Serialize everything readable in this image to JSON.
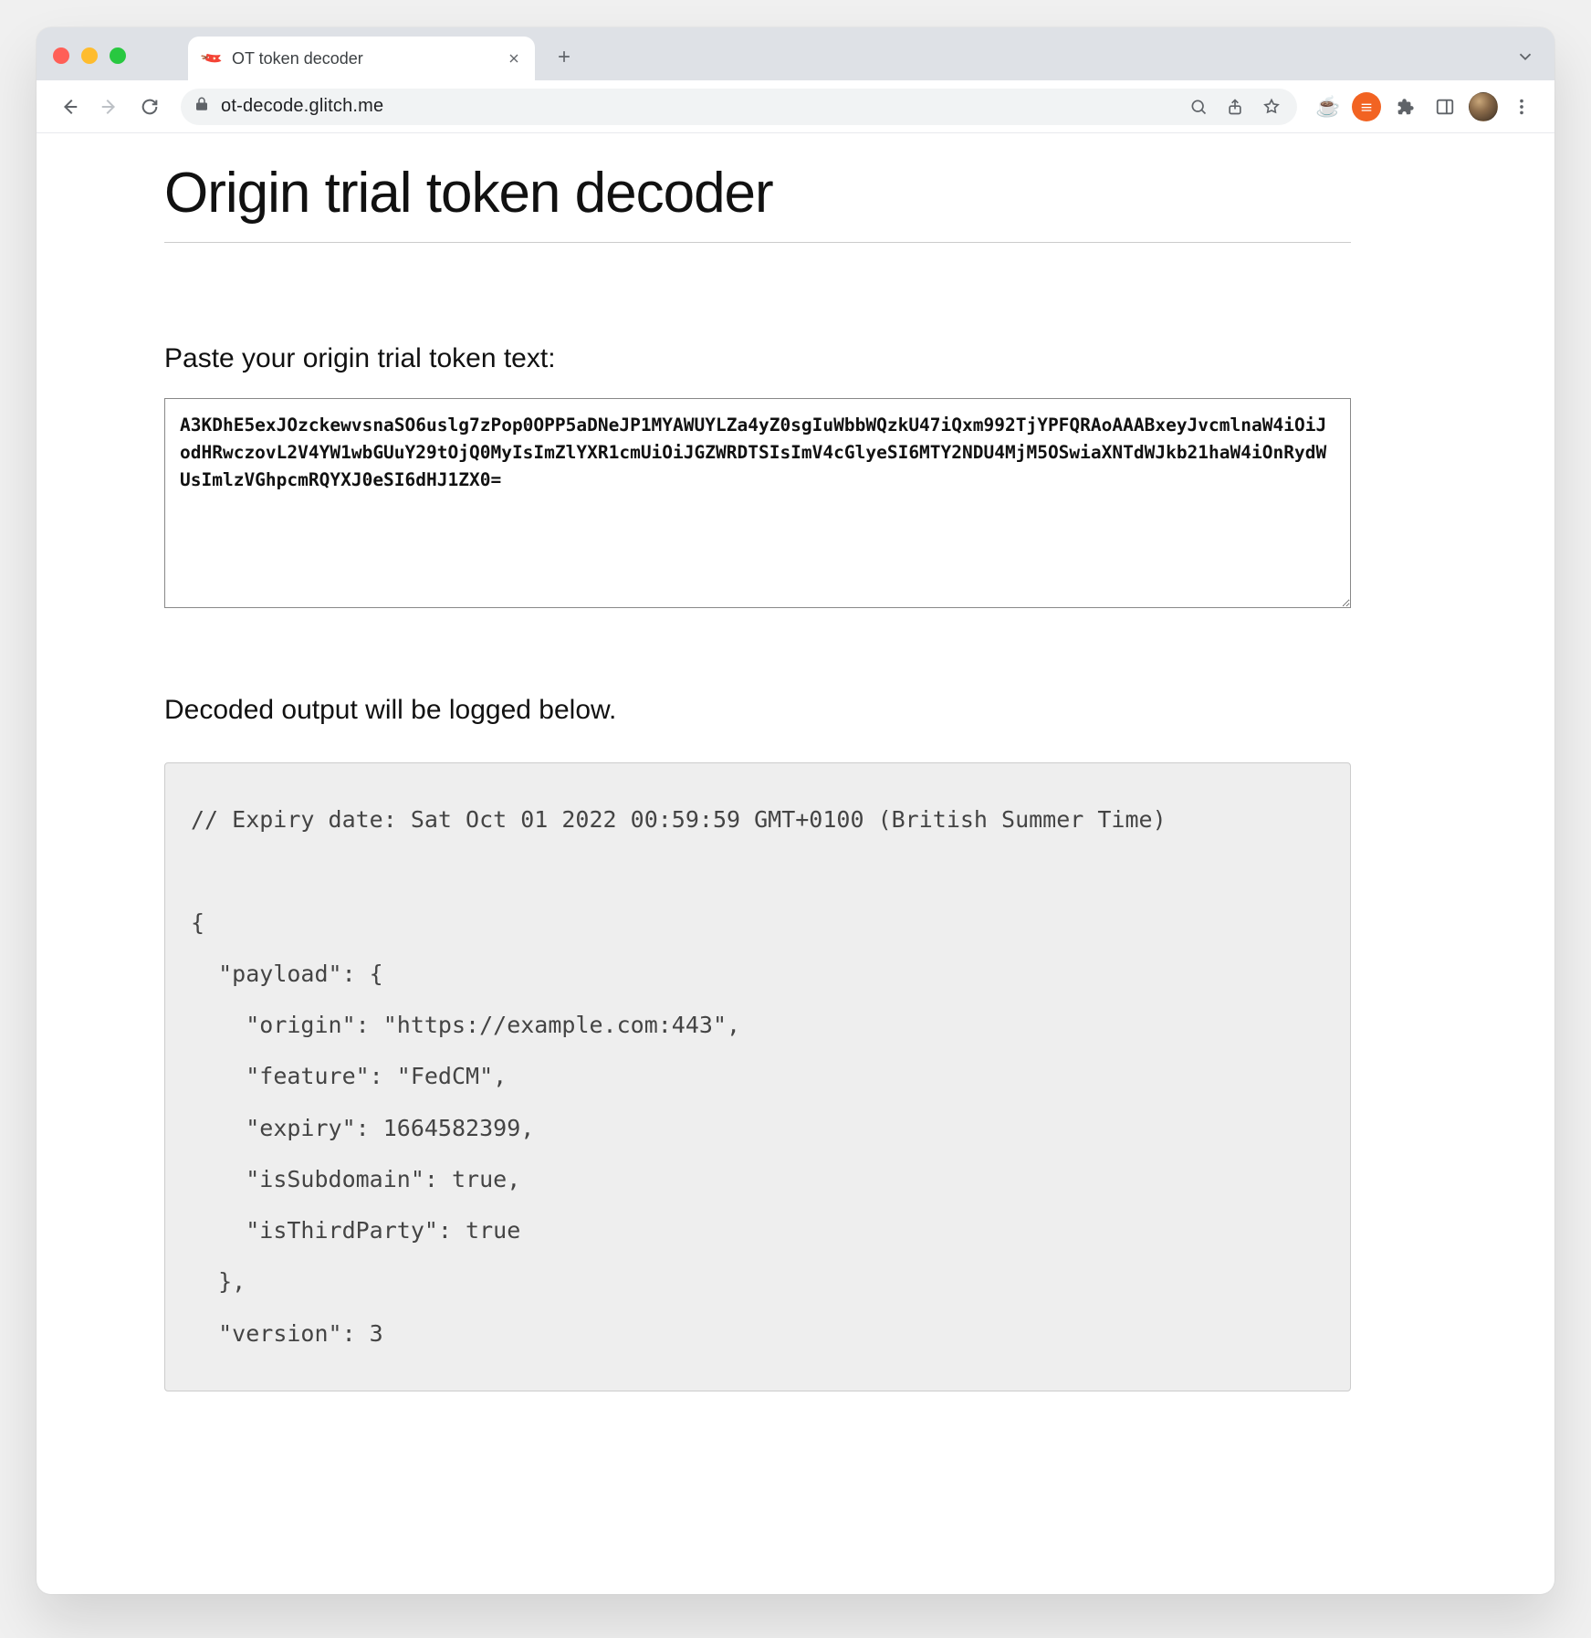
{
  "browser": {
    "tab_title": "OT token decoder",
    "favicon_glyph": "🔖",
    "url": "ot-decode.glitch.me"
  },
  "page": {
    "heading": "Origin trial token decoder",
    "input_label": "Paste your origin trial token text:",
    "token_value": "A3KDhE5exJOzckewvsnaSO6uslg7zPop0OPP5aDNeJP1MYAWUYLZa4yZ0sgIuWbbWQzkU47iQxm992TjYPFQRAoAAABxeyJvcmlnaW4iOiJodHRwczovL2V4YW1wbGUuY29tOjQ0MyIsImZlYXR1cmUiOiJGZWRDTSIsImV4cGlyeSI6MTY2NDU4MjM5OSwiaXNTdWJkb21haW4iOnRydWUsImlzVGhpcmRQYXJ0eSI6dHJ1ZX0=",
    "output_label": "Decoded output will be logged below.",
    "output_text": "// Expiry date: Sat Oct 01 2022 00:59:59 GMT+0100 (British Summer Time)\n\n{\n  \"payload\": {\n    \"origin\": \"https://example.com:443\",\n    \"feature\": \"FedCM\",\n    \"expiry\": 1664582399,\n    \"isSubdomain\": true,\n    \"isThirdParty\": true\n  },\n  \"version\": 3"
  }
}
